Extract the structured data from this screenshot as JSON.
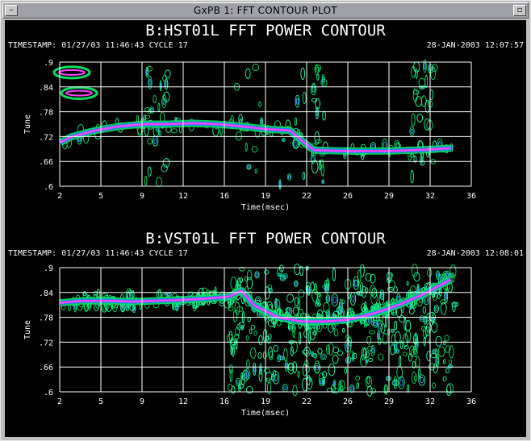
{
  "window": {
    "title": "GxPB 1: FFT CONTOUR PLOT",
    "menu_icon": "window-menu-icon",
    "minimize_icon": "minimize-icon"
  },
  "plots": [
    {
      "title": "B:HST01L FFT POWER CONTOUR",
      "timestamp": "TIMESTAMP: 01/27/03 11:46:43  CYCLE 17",
      "date": "28-JAN-2003 12:07:57",
      "ylabel": "Tune",
      "xlabel": "Time(msec)",
      "yticks": [
        ".9",
        ".84",
        ".78",
        ".72",
        ".66",
        ".6"
      ],
      "xticks": [
        "2",
        "5",
        "9",
        "12",
        "16",
        "19",
        "22",
        "26",
        "29",
        "32",
        "36"
      ]
    },
    {
      "title": "B:VST01L FFT POWER CONTOUR",
      "timestamp": "TIMESTAMP: 01/27/03 11:46:43  CYCLE 17",
      "date": "28-JAN-2003 12:08:01",
      "ylabel": "Tune",
      "xlabel": "Time(msec)",
      "yticks": [
        ".9",
        ".84",
        ".78",
        ".72",
        ".66",
        ".6"
      ],
      "xticks": [
        "2",
        "5",
        "9",
        "12",
        "16",
        "19",
        "22",
        "26",
        "29",
        "32",
        "36"
      ]
    }
  ],
  "chart_data": [
    {
      "type": "heatmap",
      "title": "B:HST01L FFT POWER CONTOUR",
      "xlabel": "Time(msec)",
      "ylabel": "Tune",
      "xlim": [
        2,
        36
      ],
      "ylim": [
        0.6,
        0.9
      ],
      "grid": true,
      "ridge": {
        "x": [
          2,
          3,
          5,
          7,
          9,
          11,
          13,
          15,
          17,
          19,
          21,
          22,
          23,
          26,
          29,
          32,
          34.5
        ],
        "y": [
          0.705,
          0.72,
          0.735,
          0.745,
          0.75,
          0.75,
          0.752,
          0.75,
          0.745,
          0.738,
          0.735,
          0.71,
          0.687,
          0.685,
          0.685,
          0.688,
          0.692
        ]
      }
    },
    {
      "type": "heatmap",
      "title": "B:VST01L FFT POWER CONTOUR",
      "xlabel": "Time(msec)",
      "ylabel": "Tune",
      "xlim": [
        2,
        36
      ],
      "ylim": [
        0.6,
        0.9
      ],
      "grid": true,
      "ridge": {
        "x": [
          2,
          4,
          6,
          8,
          10,
          12,
          14,
          16,
          17,
          18,
          20,
          22,
          24,
          26,
          28,
          30,
          32,
          34.5
        ],
        "y": [
          0.815,
          0.82,
          0.82,
          0.818,
          0.82,
          0.822,
          0.825,
          0.83,
          0.845,
          0.81,
          0.78,
          0.77,
          0.77,
          0.775,
          0.79,
          0.81,
          0.835,
          0.875
        ]
      }
    }
  ]
}
